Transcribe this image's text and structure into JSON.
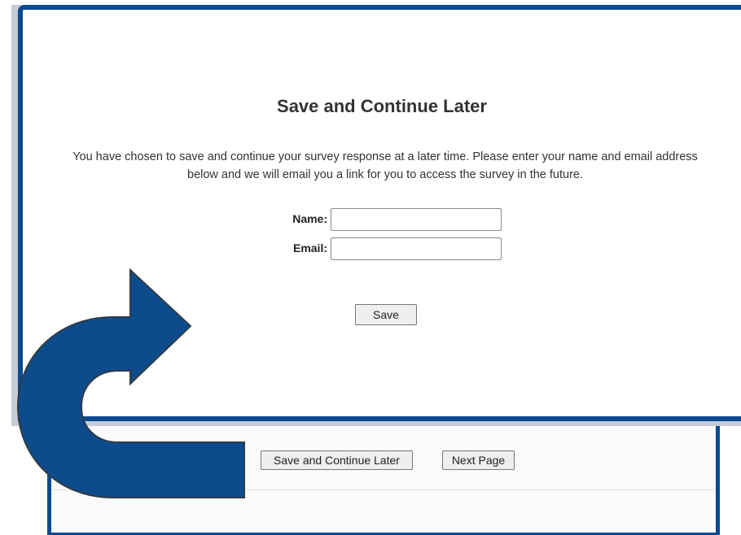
{
  "dialog": {
    "title": "Save and Continue Later",
    "description": "You have chosen to save and continue your survey response at a later time. Please enter your name and email address below and we will email you a link for you to access the survey in the future.",
    "name_label": "Name:",
    "name_value": "",
    "email_label": "Email:",
    "email_value": "",
    "save_label": "Save"
  },
  "survey_footer": {
    "save_later_label": "Save and Continue Later",
    "next_page_label": "Next Page"
  },
  "colors": {
    "accent_blue": "#0a4a91",
    "arrow_fill": "#0d4c8c",
    "arrow_outline": "#2f3b46"
  },
  "icons": {
    "overlay_arrow": "curved-arrow-icon"
  }
}
